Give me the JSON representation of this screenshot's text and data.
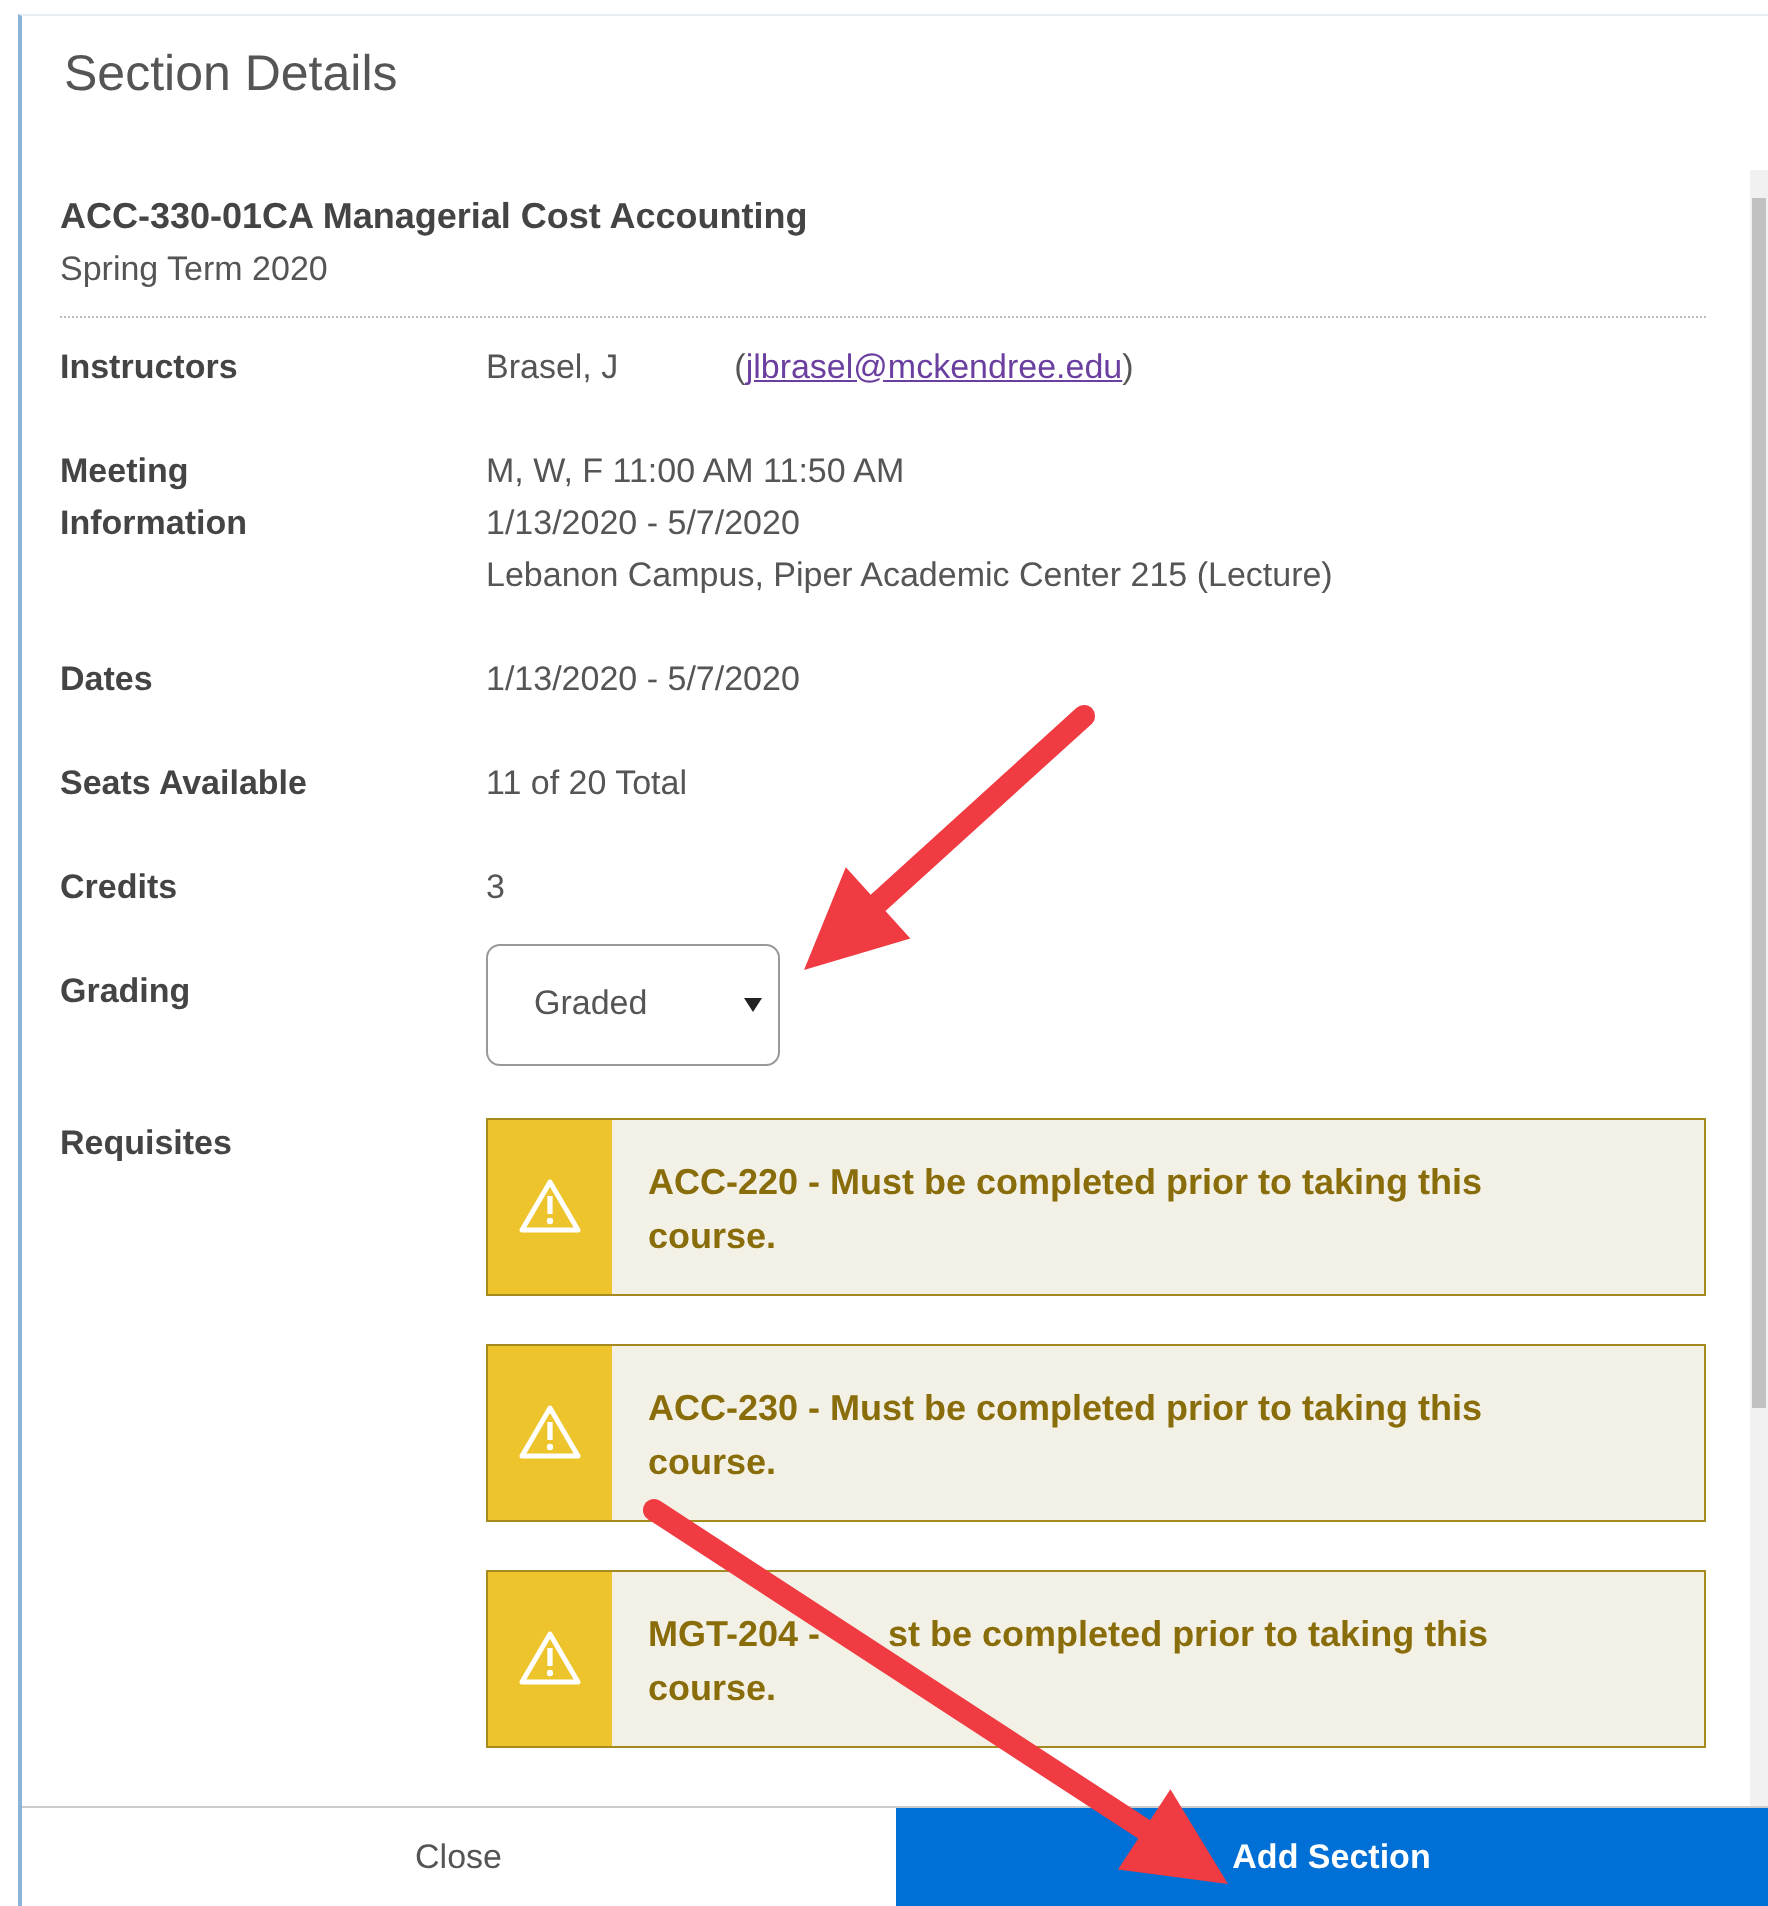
{
  "dialog": {
    "title": "Section Details"
  },
  "section": {
    "heading": "ACC-330-01CA Managerial Cost Accounting",
    "term": "Spring Term 2020"
  },
  "details": [
    {
      "kind": "instructor",
      "label": "Instructors",
      "name": "Brasel, J",
      "email": "jlbrasel@mckendree.edu",
      "open": "(",
      "close": ")"
    },
    {
      "kind": "lines",
      "label": "Meeting Information",
      "lines": [
        "M, W, F 11:00 AM 11:50 AM",
        "1/13/2020 - 5/7/2020",
        "Lebanon Campus, Piper Academic Center 215 (Lecture)"
      ]
    },
    {
      "kind": "text",
      "label": "Dates",
      "value": "1/13/2020 - 5/7/2020"
    },
    {
      "kind": "text",
      "label": "Seats Available",
      "value": "11 of 20 Total"
    },
    {
      "kind": "text",
      "label": "Credits",
      "value": "3"
    },
    {
      "kind": "select",
      "label": "Grading",
      "value": "Graded"
    },
    {
      "kind": "requisites",
      "label": "Requisites",
      "items": [
        {
          "text": "ACC-220 - Must be completed prior to taking this course."
        },
        {
          "text": "ACC-230 - Must be completed prior to taking this course."
        },
        {
          "parts": [
            "MGT-204 -",
            "st be completed prior to taking this",
            "course."
          ]
        }
      ]
    }
  ],
  "buttons": [
    {
      "label": "Close",
      "kind": "secondary"
    },
    {
      "label": "Add Section",
      "kind": "primary"
    }
  ],
  "annotations": [
    {
      "kind": "arrow"
    },
    {
      "kind": "arrow"
    }
  ]
}
